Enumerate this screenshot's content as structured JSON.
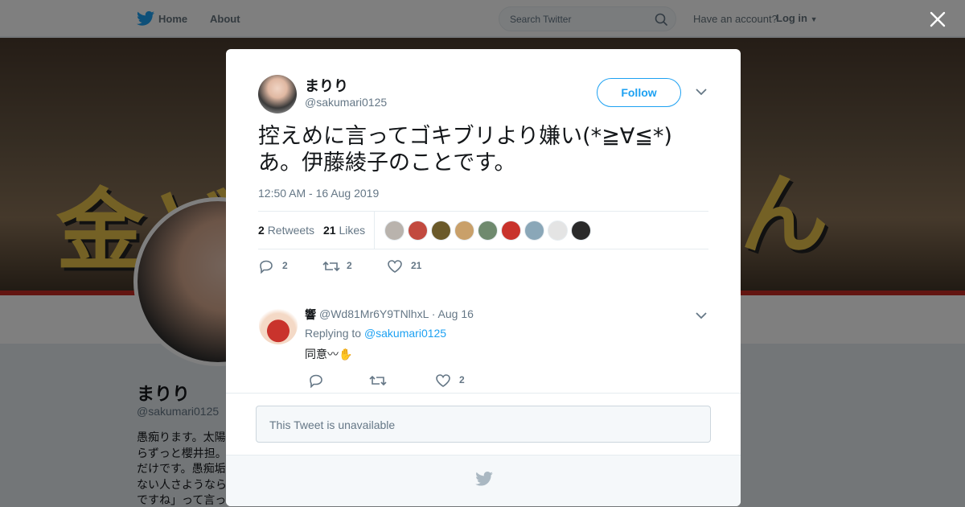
{
  "nav": {
    "home_label": "Home",
    "about_label": "About",
    "search_placeholder": "Search Twitter",
    "have_account": "Have an account?",
    "login_label": "Log in"
  },
  "background_profile": {
    "banner_text_left": "金ど",
    "banner_text_right": "んの?",
    "name": "まりり",
    "handle": "@sakumari0125",
    "bio_lines": [
      "愚痴ります。太陽",
      "らずっと櫻井担。",
      "だけです。愚痴垢",
      "ない人さようなら",
      "ですね」って言っ"
    ]
  },
  "tweet": {
    "author_name": "まりり",
    "author_handle": "@sakumari0125",
    "follow_label": "Follow",
    "text_line1": "控えめに言ってゴキブリより嫌い(*≧∀≦*)",
    "text_line2": "あ。伊藤綾子のことです。",
    "timestamp": "12:50 AM - 16 Aug 2019",
    "retweets_count": "2",
    "retweets_label": "Retweets",
    "likes_count": "21",
    "likes_label": "Likes",
    "actions": {
      "reply_count": "2",
      "retweet_count": "2",
      "like_count": "21"
    },
    "liker_colors": [
      "#b9b3ad",
      "#c24a3f",
      "#6b5a2a",
      "#c9a06a",
      "#6f8a6e",
      "#c9332c",
      "#8aa7b8",
      "#e4e4e4",
      "#2a2a2a"
    ]
  },
  "reply": {
    "author_name": "響",
    "author_handle": "@Wd81Mr6Y9TNlhxL",
    "separator": "·",
    "date": "Aug 16",
    "replying_to_label": "Replying to",
    "replying_to_handle": "@sakumari0125",
    "text": "同意〰✋",
    "like_count": "2"
  },
  "unavailable_text": "This Tweet is unavailable",
  "colors": {
    "twitter_blue": "#1da1f2",
    "muted_text": "#657786"
  }
}
